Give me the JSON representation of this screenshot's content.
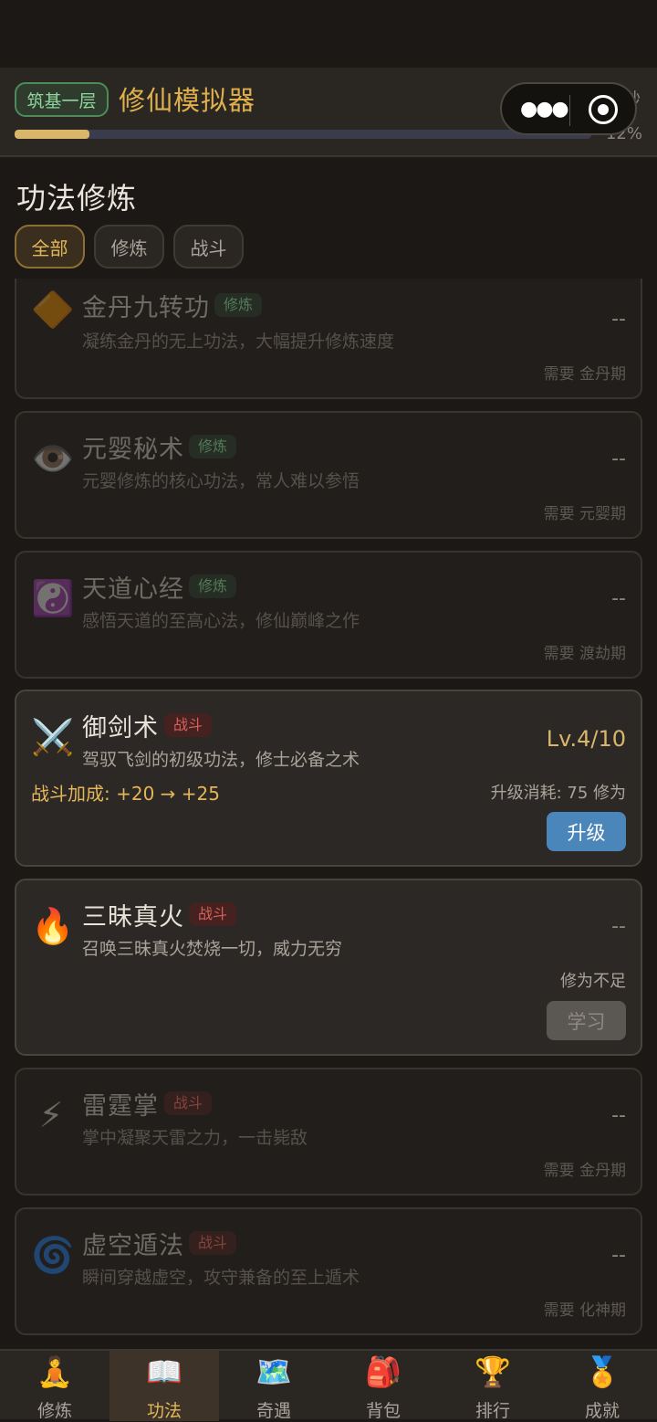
{
  "header": {
    "realm": "筑基一层",
    "title": "修仙模拟器",
    "rate": "5/秒",
    "percent": "12%",
    "progress": 0.13
  },
  "section_title": "功法修炼",
  "filters": [
    {
      "label": "全部",
      "active": true
    },
    {
      "label": "修炼",
      "active": false
    },
    {
      "label": "战斗",
      "active": false
    }
  ],
  "cards": [
    {
      "icon": "🔶",
      "icon_name": "orange-diamond-icon",
      "name": "金丹九转功",
      "tag": "修炼",
      "desc": "凝练金丹的无上功法，大幅提升修炼速度",
      "level": "--",
      "req": "需要 金丹期"
    },
    {
      "icon": "👁️",
      "icon_name": "eye-icon",
      "name": "元婴秘术",
      "tag": "修炼",
      "desc": "元婴修炼的核心功法，常人难以参悟",
      "level": "--",
      "req": "需要 元婴期"
    },
    {
      "icon": "☯️",
      "icon_name": "yin-yang-icon",
      "name": "天道心经",
      "tag": "修炼",
      "desc": "感悟天道的至高心法，修仙巅峰之作",
      "level": "--",
      "req": "需要 渡劫期"
    },
    {
      "icon": "⚔️",
      "icon_name": "crossed-swords-icon",
      "name": "御剑术",
      "tag": "战斗",
      "desc": "驾驭飞剑的初级功法，修士必备之术",
      "level": "Lv.4/10",
      "bonus": "战斗加成: +20 → +25",
      "cost": "升级消耗: 75 修为",
      "button": "升级"
    },
    {
      "icon": "🔥",
      "icon_name": "fire-icon",
      "name": "三昧真火",
      "tag": "战斗",
      "desc": "召唤三昧真火焚烧一切，威力无穷",
      "level": "--",
      "shortage": "修为不足",
      "button": "学习"
    },
    {
      "icon": "⚡",
      "icon_name": "lightning-icon",
      "name": "雷霆掌",
      "tag": "战斗",
      "desc": "掌中凝聚天雷之力，一击毙敌",
      "level": "--",
      "req": "需要 金丹期"
    },
    {
      "icon": "🌀",
      "icon_name": "cyclone-icon",
      "name": "虚空遁法",
      "tag": "战斗",
      "desc": "瞬间穿越虚空，攻守兼备的至上遁术",
      "level": "--",
      "req": "需要 化神期"
    }
  ],
  "nav": [
    {
      "icon": "🧘",
      "icon_name": "meditation-icon",
      "label": "修炼"
    },
    {
      "icon": "📖",
      "icon_name": "open-book-icon",
      "label": "功法"
    },
    {
      "icon": "🗺️",
      "icon_name": "world-map-icon",
      "label": "奇遇"
    },
    {
      "icon": "🎒",
      "icon_name": "backpack-icon",
      "label": "背包"
    },
    {
      "icon": "🏆",
      "icon_name": "trophy-icon",
      "label": "排行"
    },
    {
      "icon": "🏅",
      "icon_name": "medal-icon",
      "label": "成就"
    }
  ],
  "colors": {
    "accent_gold": "#e4b659",
    "upgrade_button": "#4b86bb",
    "cultivation_tag": "#7ec58b",
    "combat_tag": "#d9605a",
    "background": "#1b1815"
  }
}
